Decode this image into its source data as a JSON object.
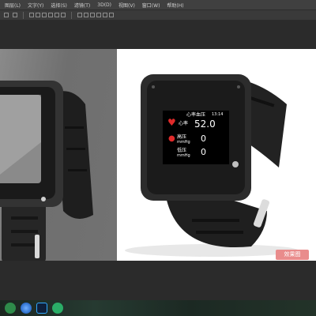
{
  "menubar": {
    "items": [
      "图层(L)",
      "文字(Y)",
      "选择(S)",
      "滤镜(T)",
      "3D(D)",
      "视图(V)",
      "窗口(W)",
      "帮助(H)"
    ]
  },
  "watch_screen": {
    "title": "心率血压",
    "time": "13:14",
    "heart_label": "心率",
    "heart_value": "52.0",
    "high_label": "高压",
    "high_unit": "mmHg",
    "high_value": "0",
    "low_label": "低压",
    "low_unit": "mmHg",
    "low_value": "0"
  },
  "badge": {
    "label": "效果图"
  },
  "taskbar": {
    "icons": [
      "windows-start-icon",
      "browser-icon",
      "photoshop-icon",
      "wechat-icon"
    ]
  },
  "colors": {
    "app_bg": "#535353",
    "menubar_bg": "#404040",
    "heart_red": "#e02a2a",
    "badge_bg": "#e98c8c"
  }
}
